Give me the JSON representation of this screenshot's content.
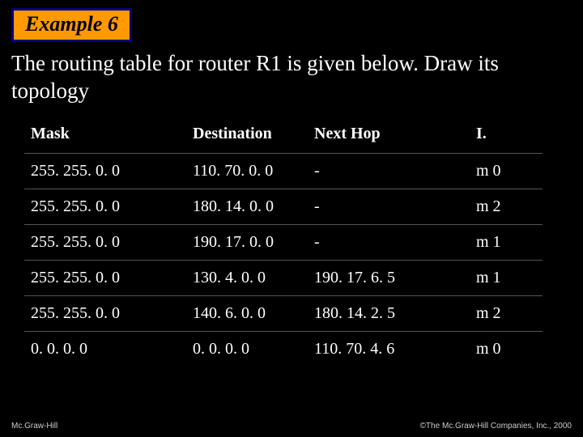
{
  "badge": "Example 6",
  "prompt": "The routing table for router R1 is given below. Draw its topology",
  "table": {
    "headers": [
      "Mask",
      "Destination",
      "Next Hop",
      "I."
    ],
    "rows": [
      [
        "255. 255. 0. 0",
        "110. 70. 0. 0",
        "-",
        "m 0"
      ],
      [
        "255. 255. 0. 0",
        "180. 14. 0. 0",
        "-",
        "m 2"
      ],
      [
        "255. 255. 0. 0",
        "190. 17. 0. 0",
        "-",
        "m 1"
      ],
      [
        "255. 255. 0. 0",
        "130. 4. 0. 0",
        "190. 17. 6. 5",
        "m 1"
      ],
      [
        "255. 255. 0. 0",
        "140. 6. 0. 0",
        "180. 14. 2. 5",
        "m 2"
      ],
      [
        "0. 0. 0. 0",
        "0. 0. 0. 0",
        "110. 70. 4. 6",
        "m 0"
      ]
    ]
  },
  "footer": {
    "left": "Mc.Graw-Hill",
    "right": "©The Mc.Graw-Hill Companies, Inc., 2000"
  }
}
